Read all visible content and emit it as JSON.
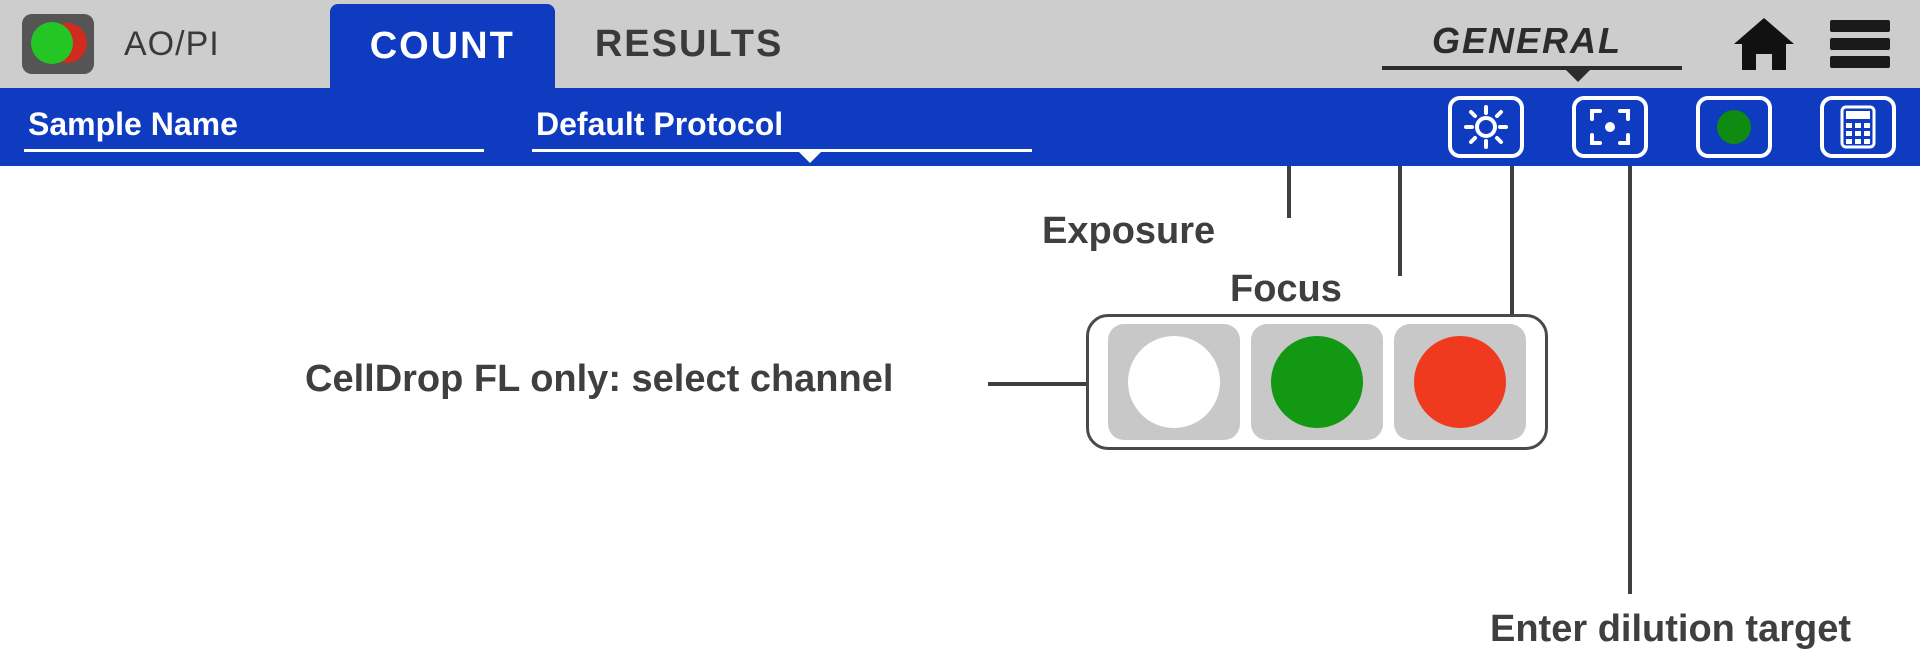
{
  "assay": {
    "label": "AO/PI"
  },
  "tabs": {
    "count": "COUNT",
    "results": "RESULTS"
  },
  "mode": {
    "selected": "GENERAL"
  },
  "subbar": {
    "sample_name_placeholder": "Sample Name",
    "protocol_selected": "Default Protocol"
  },
  "annotations": {
    "exposure": "Exposure",
    "focus": "Focus",
    "channel": "CellDrop FL only: select channel",
    "dilution": "Enter dilution target"
  },
  "icons": {
    "home": "home-icon",
    "menu": "menu-icon",
    "exposure": "brightness-icon",
    "focus": "focus-target-icon",
    "channel": "channel-indicator-icon",
    "calculator": "calculator-icon"
  },
  "channels": {
    "white": "brightfield-channel",
    "green": "green-fluorescence-channel",
    "red": "red-fluorescence-channel"
  },
  "colors": {
    "accent_blue": "#0e3bc0",
    "toolbar_grey": "#cdcdcd",
    "green": "#129813",
    "red": "#ef3a20"
  }
}
